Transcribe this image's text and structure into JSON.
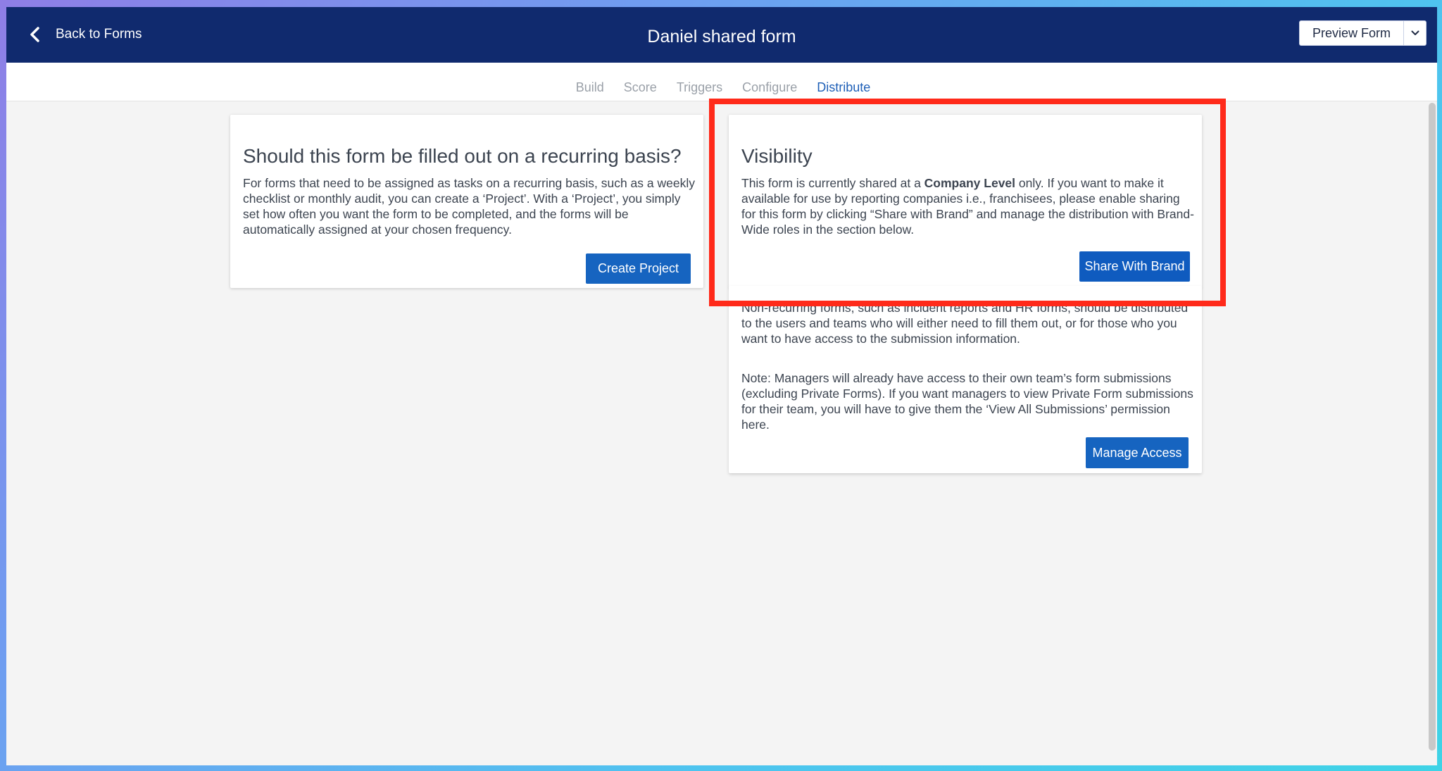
{
  "header": {
    "back_label": "Back to Forms",
    "title": "Daniel shared form",
    "preview_label": "Preview Form"
  },
  "tabs": [
    {
      "label": "Build"
    },
    {
      "label": "Score"
    },
    {
      "label": "Triggers"
    },
    {
      "label": "Configure"
    },
    {
      "label": "Distribute",
      "active": true
    }
  ],
  "recurring_card": {
    "title": "Should this form be filled out on a recurring basis?",
    "body": "For forms that need to be assigned as tasks on a recurring basis, such as a weekly checklist or monthly audit, you can create a ‘Project’. With a ‘Project’, you simply set how often you want the form to be completed, and the forms will be automatically assigned at your chosen frequency.",
    "button_label": "Create Project"
  },
  "visibility_card": {
    "title": "Visibility",
    "body_prefix": "This form is currently shared at a ",
    "body_bold": "Company Level",
    "body_suffix": " only. If you want to make it available for use by reporting companies i.e., franchisees, please enable sharing for this form by clicking “Share with Brand” and manage the distribution with Brand-Wide roles in the section below.",
    "button_label": "Share With Brand"
  },
  "access_card": {
    "paragraph1": "Non-recurring forms, such as incident reports and HR forms, should be distributed to the users and teams who will either need to fill them out, or for those who you want to have access to the submission information.",
    "paragraph2": "Note: Managers will already have access to their own team’s form submissions (excluding Private Forms). If you want managers to view Private Form submissions for their team, you will have to give them the ‘View All Submissions’ permission here.",
    "button_label": "Manage Access"
  },
  "colors": {
    "header_bg": "#102a6e",
    "accent": "#1664c0",
    "highlight": "#ff2a1a"
  }
}
